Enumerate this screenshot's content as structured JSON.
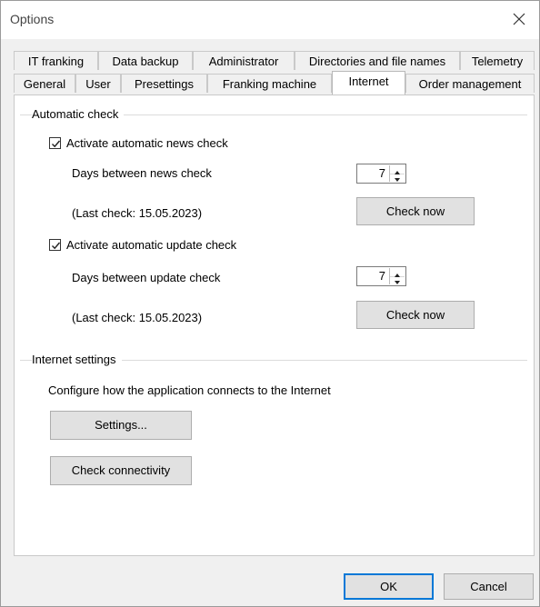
{
  "window": {
    "title": "Options"
  },
  "tabs": {
    "row1": [
      "IT franking",
      "Data backup",
      "Administrator",
      "Directories and file names",
      "Telemetry"
    ],
    "row2": [
      "General",
      "User",
      "Presettings",
      "Franking machine",
      "Internet",
      "Order management"
    ],
    "active": "Internet"
  },
  "automatic_check": {
    "group_title": "Automatic check",
    "news": {
      "checkbox_label": "Activate automatic news check",
      "checked": true,
      "days_label": "Days between news check",
      "days_value": "7",
      "last_check": "(Last check: 15.05.2023)",
      "button": "Check now"
    },
    "update": {
      "checkbox_label": "Activate automatic update check",
      "checked": true,
      "days_label": "Days between update check",
      "days_value": "7",
      "last_check": "(Last check: 15.05.2023)",
      "button": "Check now"
    }
  },
  "internet_settings": {
    "group_title": "Internet settings",
    "description": "Configure how the application connects to the Internet",
    "settings_button": "Settings...",
    "connectivity_button": "Check connectivity"
  },
  "dialog": {
    "ok": "OK",
    "cancel": "Cancel"
  },
  "colors": {
    "accent": "#0078d7",
    "panel": "#ffffff",
    "window": "#f0f0f0"
  }
}
